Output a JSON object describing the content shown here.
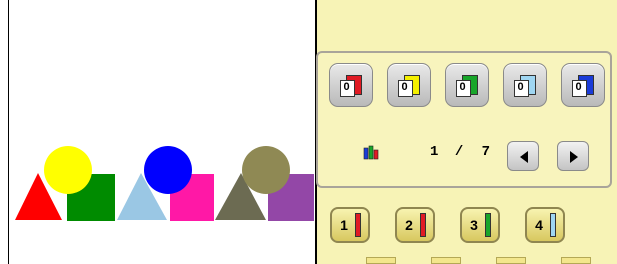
{
  "palette": {
    "swatches": [
      {
        "number": "0",
        "color": "#e01b24"
      },
      {
        "number": "0",
        "color": "#f5f000"
      },
      {
        "number": "0",
        "color": "#18a52a"
      },
      {
        "number": "0",
        "color": "#9fd6f2"
      },
      {
        "number": "0",
        "color": "#1a3bd8"
      }
    ],
    "pager": {
      "current": "1",
      "separator": "/",
      "total": "7"
    }
  },
  "needles": [
    {
      "number": "1",
      "color": "#e01b24"
    },
    {
      "number": "2",
      "color": "#e01b24"
    },
    {
      "number": "3",
      "color": "#18a52a"
    },
    {
      "number": "4",
      "color": "#9fd6f2"
    }
  ],
  "design_shapes": {
    "triangles": [
      "#ff0000",
      "#9ac7e4",
      "#6c6b52"
    ],
    "circles": [
      "#ffff00",
      "#0000ff",
      "#8f8954"
    ],
    "squares": [
      "#008b00",
      "#ff18a6",
      "#9347a7"
    ]
  }
}
